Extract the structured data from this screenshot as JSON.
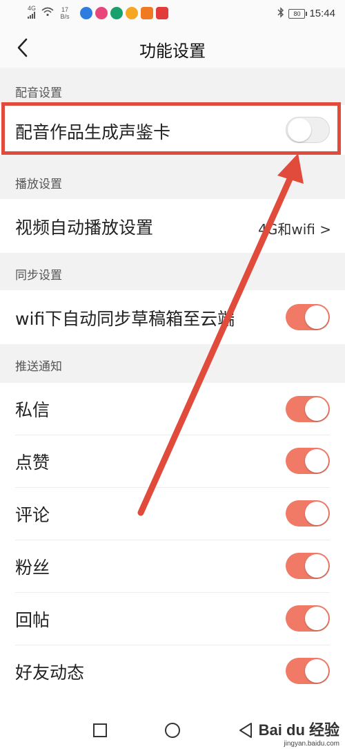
{
  "status_bar": {
    "network": "4G",
    "speed_value": "17",
    "speed_unit": "B/s",
    "battery": "80",
    "time": "15:44",
    "app_icon_colors": [
      "#2d7de0",
      "#e8467a",
      "#1aa06d",
      "#f5a623",
      "#f07a22",
      "#e23b3b"
    ],
    "icons": [
      "signal-icon",
      "wifi-icon",
      "bluetooth-icon",
      "battery-icon"
    ]
  },
  "header": {
    "title": "功能设置",
    "back_icon": "chevron-left-icon"
  },
  "sections": {
    "dubbing": {
      "title": "配音设置",
      "item_label": "配音作品生成声鉴卡",
      "item_on": false
    },
    "playback": {
      "title": "播放设置",
      "item_label": "视频自动播放设置",
      "item_value": "4G和wifi >"
    },
    "sync": {
      "title": "同步设置",
      "item_label": "wifi下自动同步草稿箱至云端",
      "item_on": true
    },
    "push": {
      "title": "推送通知",
      "items": [
        {
          "label": "私信",
          "on": true
        },
        {
          "label": "点赞",
          "on": true
        },
        {
          "label": "评论",
          "on": true
        },
        {
          "label": "粉丝",
          "on": true
        },
        {
          "label": "回帖",
          "on": true
        },
        {
          "label": "好友动态",
          "on": true
        }
      ]
    }
  },
  "colors": {
    "accent_on": "#f07a66",
    "annotation_red": "#e04b3c"
  },
  "nav_bar": {
    "icons": [
      "square-icon",
      "circle-icon",
      "triangle-back-icon"
    ]
  },
  "watermark": {
    "main": "Bai du 经验",
    "sub": "jingyan.baidu.com"
  }
}
